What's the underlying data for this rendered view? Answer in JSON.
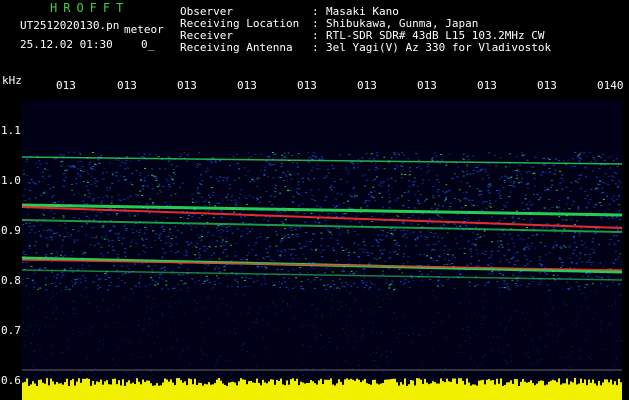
{
  "header": {
    "app_title": "HROFFT",
    "file_name": "UT2512020130.pn",
    "type_label": "meteor",
    "date_time": "25.12.02 01:30",
    "count": "0_",
    "info": [
      {
        "label": "Observer",
        "value": "Masaki Kano"
      },
      {
        "label": "Receiving Location",
        "value": "Shibukawa, Gunma, Japan"
      },
      {
        "label": "Receiver",
        "value": "RTL-SDR SDR# 43dB L15 103.2MHz CW"
      },
      {
        "label": "Receiving Antenna",
        "value": "3el Yagi(V) Az 330 for Vladivostok"
      }
    ]
  },
  "axis": {
    "unit": "kHz",
    "x_ticks": [
      "013",
      "013",
      "013",
      "013",
      "013",
      "013",
      "013",
      "013",
      "013",
      "0140"
    ],
    "y_ticks": [
      "1.1",
      "1.0",
      "0.9",
      "0.8",
      "0.7",
      "0.6"
    ]
  },
  "colors": {
    "background": "#000000",
    "spectrum_bg": "#000016",
    "title": "#3bd13b",
    "signal_strong": "#ff3030",
    "signal_mid": "#30ff60",
    "signal_weak": "#2060ff",
    "noise_bar": "#f0f000"
  }
}
